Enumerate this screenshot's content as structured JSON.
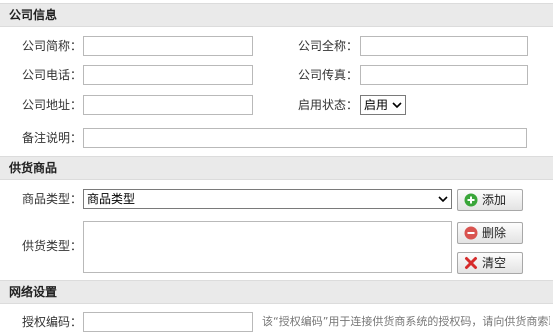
{
  "sections": {
    "company_info": "公司信息",
    "supply_goods": "供货商品",
    "network": "网络设置"
  },
  "company": {
    "short_name_label": "公司简称：",
    "short_name_value": "",
    "full_name_label": "公司全称：",
    "full_name_value": "",
    "phone_label": "公司电话：",
    "phone_value": "",
    "fax_label": "公司传真：",
    "fax_value": "",
    "address_label": "公司地址：",
    "address_value": "",
    "status_label": "启用状态：",
    "status_value": "启用",
    "remark_label": "备注说明：",
    "remark_value": ""
  },
  "goods": {
    "type_label": "商品类型：",
    "type_value": "商品类型",
    "add_button": "添加",
    "supply_type_label": "供货类型：",
    "delete_button": "删除",
    "clear_button": "清空"
  },
  "network": {
    "auth_code_label": "授权编码：",
    "auth_code_value": "",
    "hint": "该“授权编码”用于连接供货商系统的授权码，请向供货商索取。"
  },
  "icons": {
    "add": "plus-circle-icon",
    "delete": "minus-circle-icon",
    "clear": "red-x-icon",
    "dropdown": "chevron-down-icon"
  },
  "colors": {
    "section_bg": "#eaeaea",
    "add_icon": "#3aa63a",
    "delete_icon": "#d9534f",
    "clear_icon": "#d62b2b"
  }
}
